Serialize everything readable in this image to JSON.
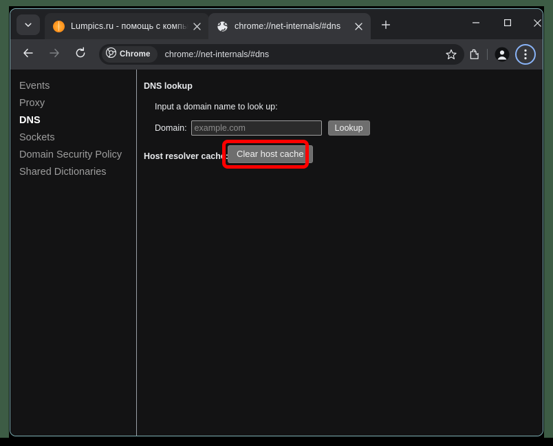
{
  "window": {
    "controls": {
      "minimize": "minimize-button",
      "maximize": "maximize-button",
      "close": "close-button"
    }
  },
  "tabstrip": {
    "tab_search_icon": "chevron-down-icon",
    "new_tab_label": "+",
    "tabs": [
      {
        "title": "Lumpics.ru - помощь с компьютером",
        "favicon": "orange-slice-icon",
        "active": false,
        "close_label": "×"
      },
      {
        "title": "chrome://net-internals/#dns",
        "favicon": "globe-icon",
        "active": true,
        "close_label": "×"
      }
    ]
  },
  "toolbar": {
    "back_icon": "arrow-left-icon",
    "forward_icon": "arrow-right-icon",
    "reload_icon": "reload-icon",
    "chrome_chip_label": "Chrome",
    "chrome_chip_icon": "chrome-logo-icon",
    "url": "chrome://net-internals/#dns",
    "star_icon": "star-icon",
    "extensions_icon": "puzzle-piece-icon",
    "profile_icon": "account-avatar-icon",
    "menu_icon": "three-dot-menu-icon"
  },
  "sidebar": {
    "items": [
      {
        "label": "Events",
        "selected": false
      },
      {
        "label": "Proxy",
        "selected": false
      },
      {
        "label": "DNS",
        "selected": true
      },
      {
        "label": "Sockets",
        "selected": false
      },
      {
        "label": "Domain Security Policy",
        "selected": false
      },
      {
        "label": "Shared Dictionaries",
        "selected": false
      }
    ]
  },
  "content": {
    "heading": "DNS lookup",
    "input_prompt": "Input a domain name to look up:",
    "domain_label": "Domain:",
    "domain_value": "",
    "domain_placeholder": "example.com",
    "lookup_button": "Lookup",
    "resolver_label": "Host resolver cache:",
    "clear_cache_button": "Clear host cache"
  },
  "annotation": {
    "highlight_color": "#ff0000",
    "target": "clear-host-cache-button"
  }
}
